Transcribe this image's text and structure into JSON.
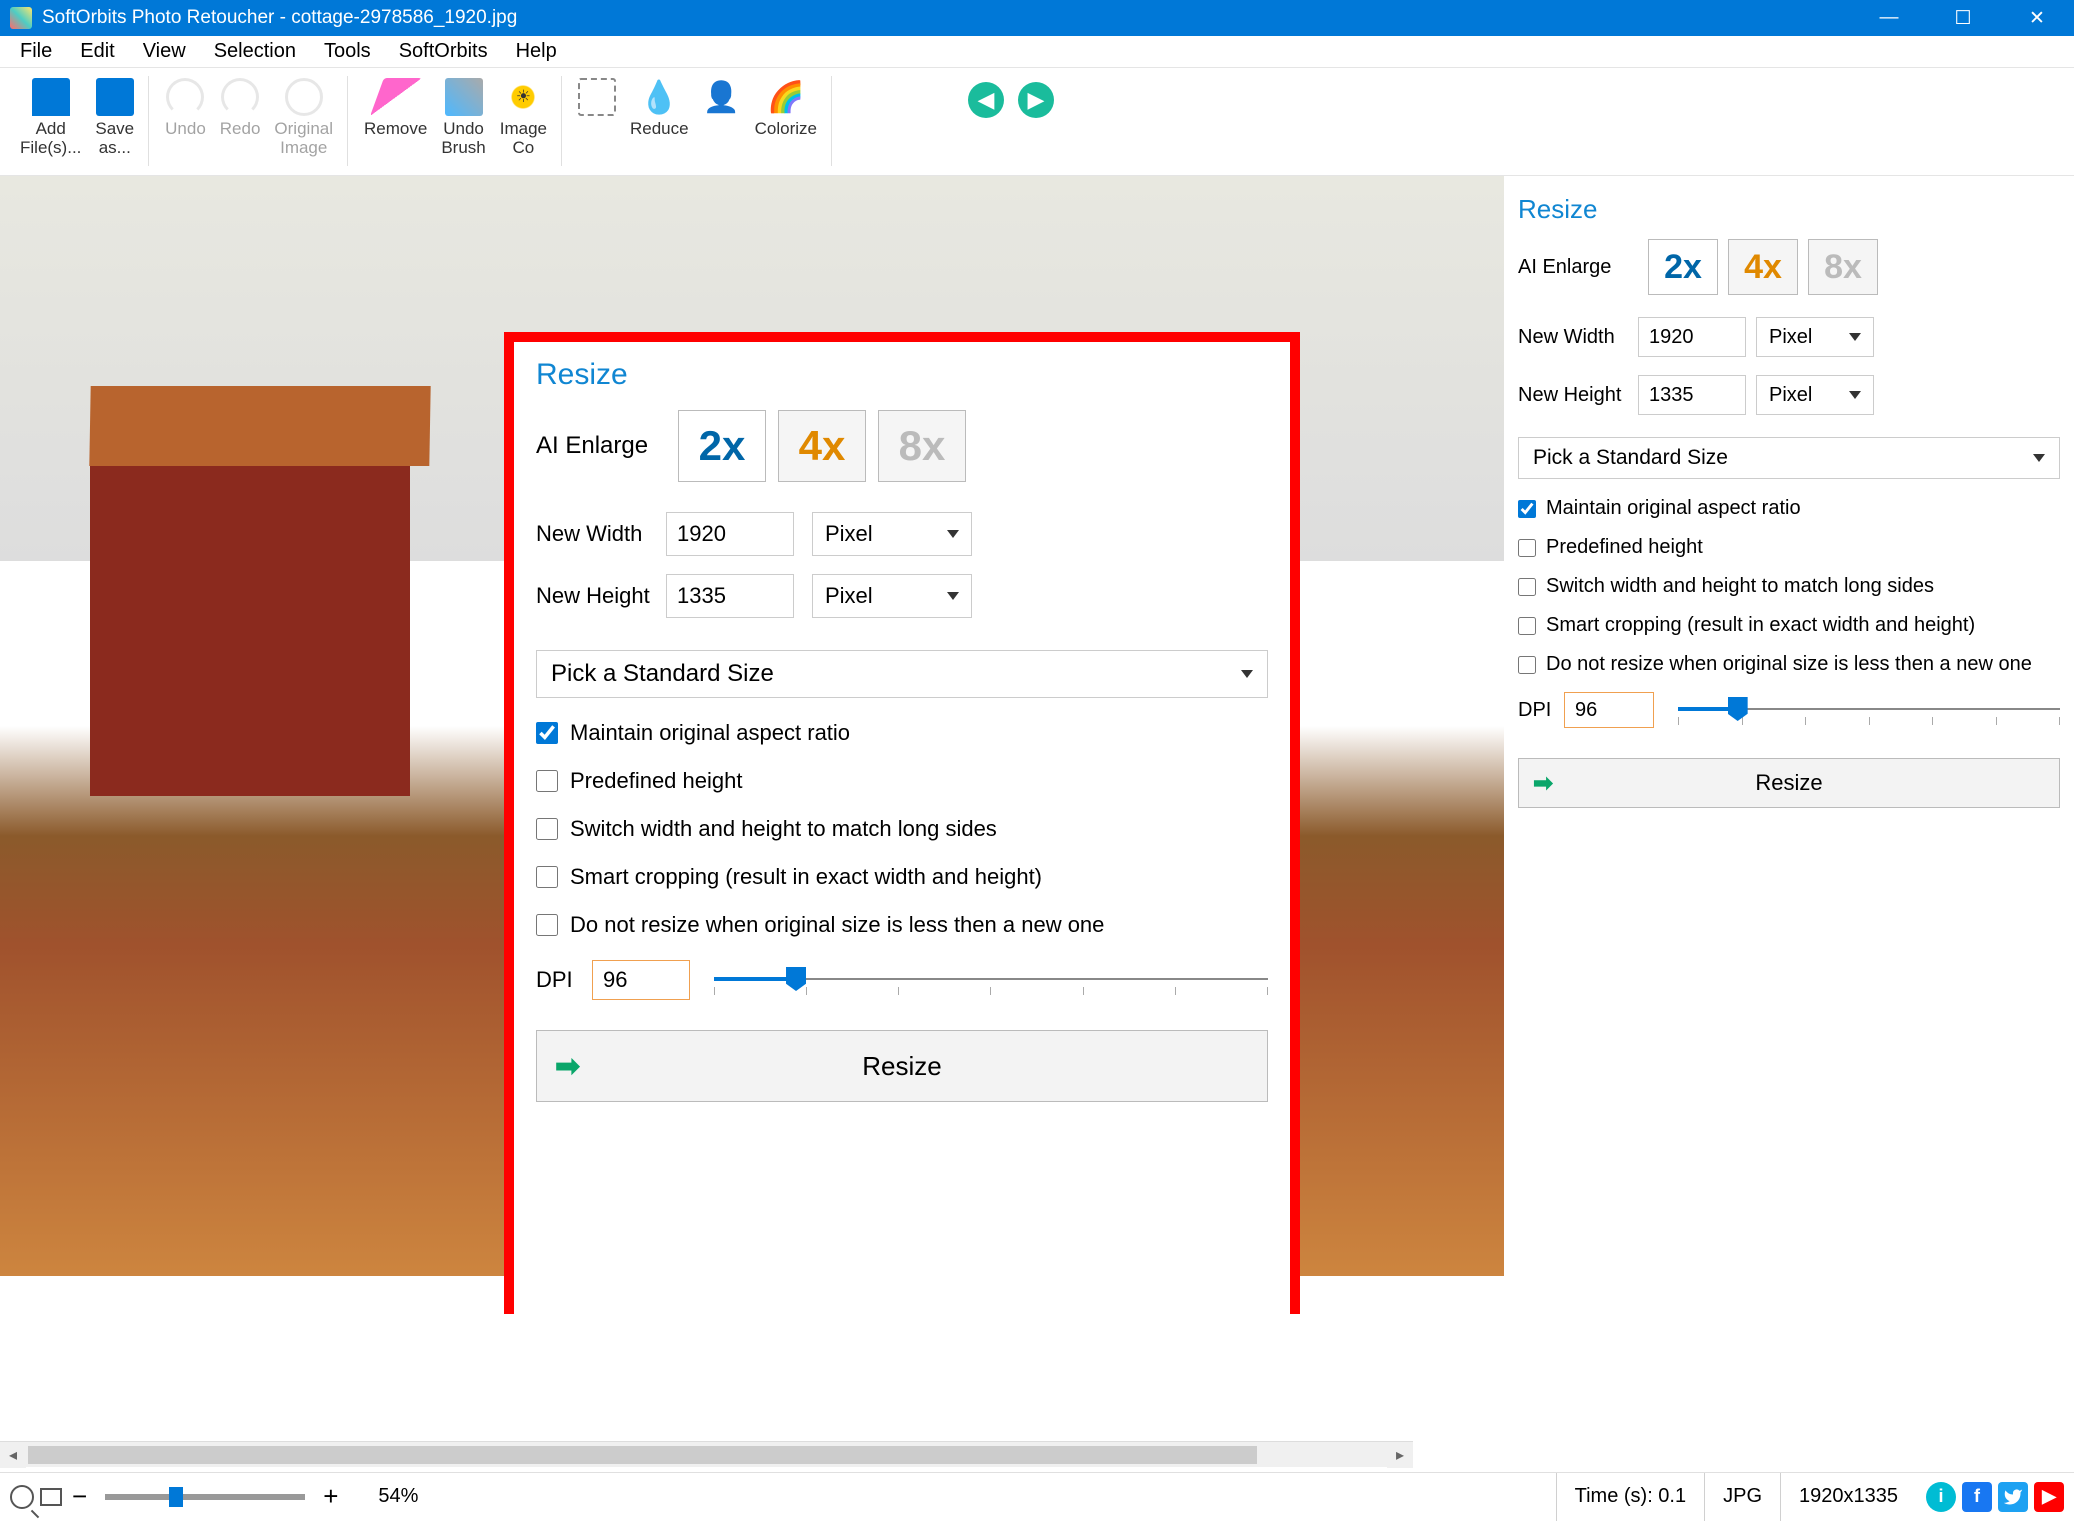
{
  "titlebar": {
    "text": "SoftOrbits Photo Retoucher - cottage-2978586_1920.jpg"
  },
  "menu": {
    "file": "File",
    "edit": "Edit",
    "view": "View",
    "selection": "Selection",
    "tools": "Tools",
    "softorbits": "SoftOrbits",
    "help": "Help"
  },
  "toolbar": {
    "add": "Add\nFile(s)...",
    "save": "Save\nas...",
    "undo": "Undo",
    "redo": "Redo",
    "orig": "Original\nImage",
    "remove": "Remove",
    "undobrush": "Undo\nBrush",
    "image": "Image\nCo",
    "reduce": "Reduce",
    "colorize": "Colorize"
  },
  "resize": {
    "title": "Resize",
    "ai_label": "AI Enlarge",
    "mag2": "2x",
    "mag4": "4x",
    "mag8": "8x",
    "width_label": "New Width",
    "width_val": "1920",
    "width_unit": "Pixel",
    "height_label": "New Height",
    "height_val": "1335",
    "height_unit": "Pixel",
    "std": "Pick a Standard Size",
    "chk_aspect": "Maintain original aspect ratio",
    "chk_predef": "Predefined height",
    "chk_switch": "Switch width and height to match long sides",
    "chk_smart": "Smart cropping (result in exact width and height)",
    "chk_noresize": "Do not resize when original size is less then a new one",
    "dpi_label": "DPI",
    "dpi_val": "96",
    "btn": "Resize"
  },
  "status": {
    "zoom": "54%",
    "time_lbl": "Time (s): 0.1",
    "fmt": "JPG",
    "dims": "1920x1335"
  }
}
